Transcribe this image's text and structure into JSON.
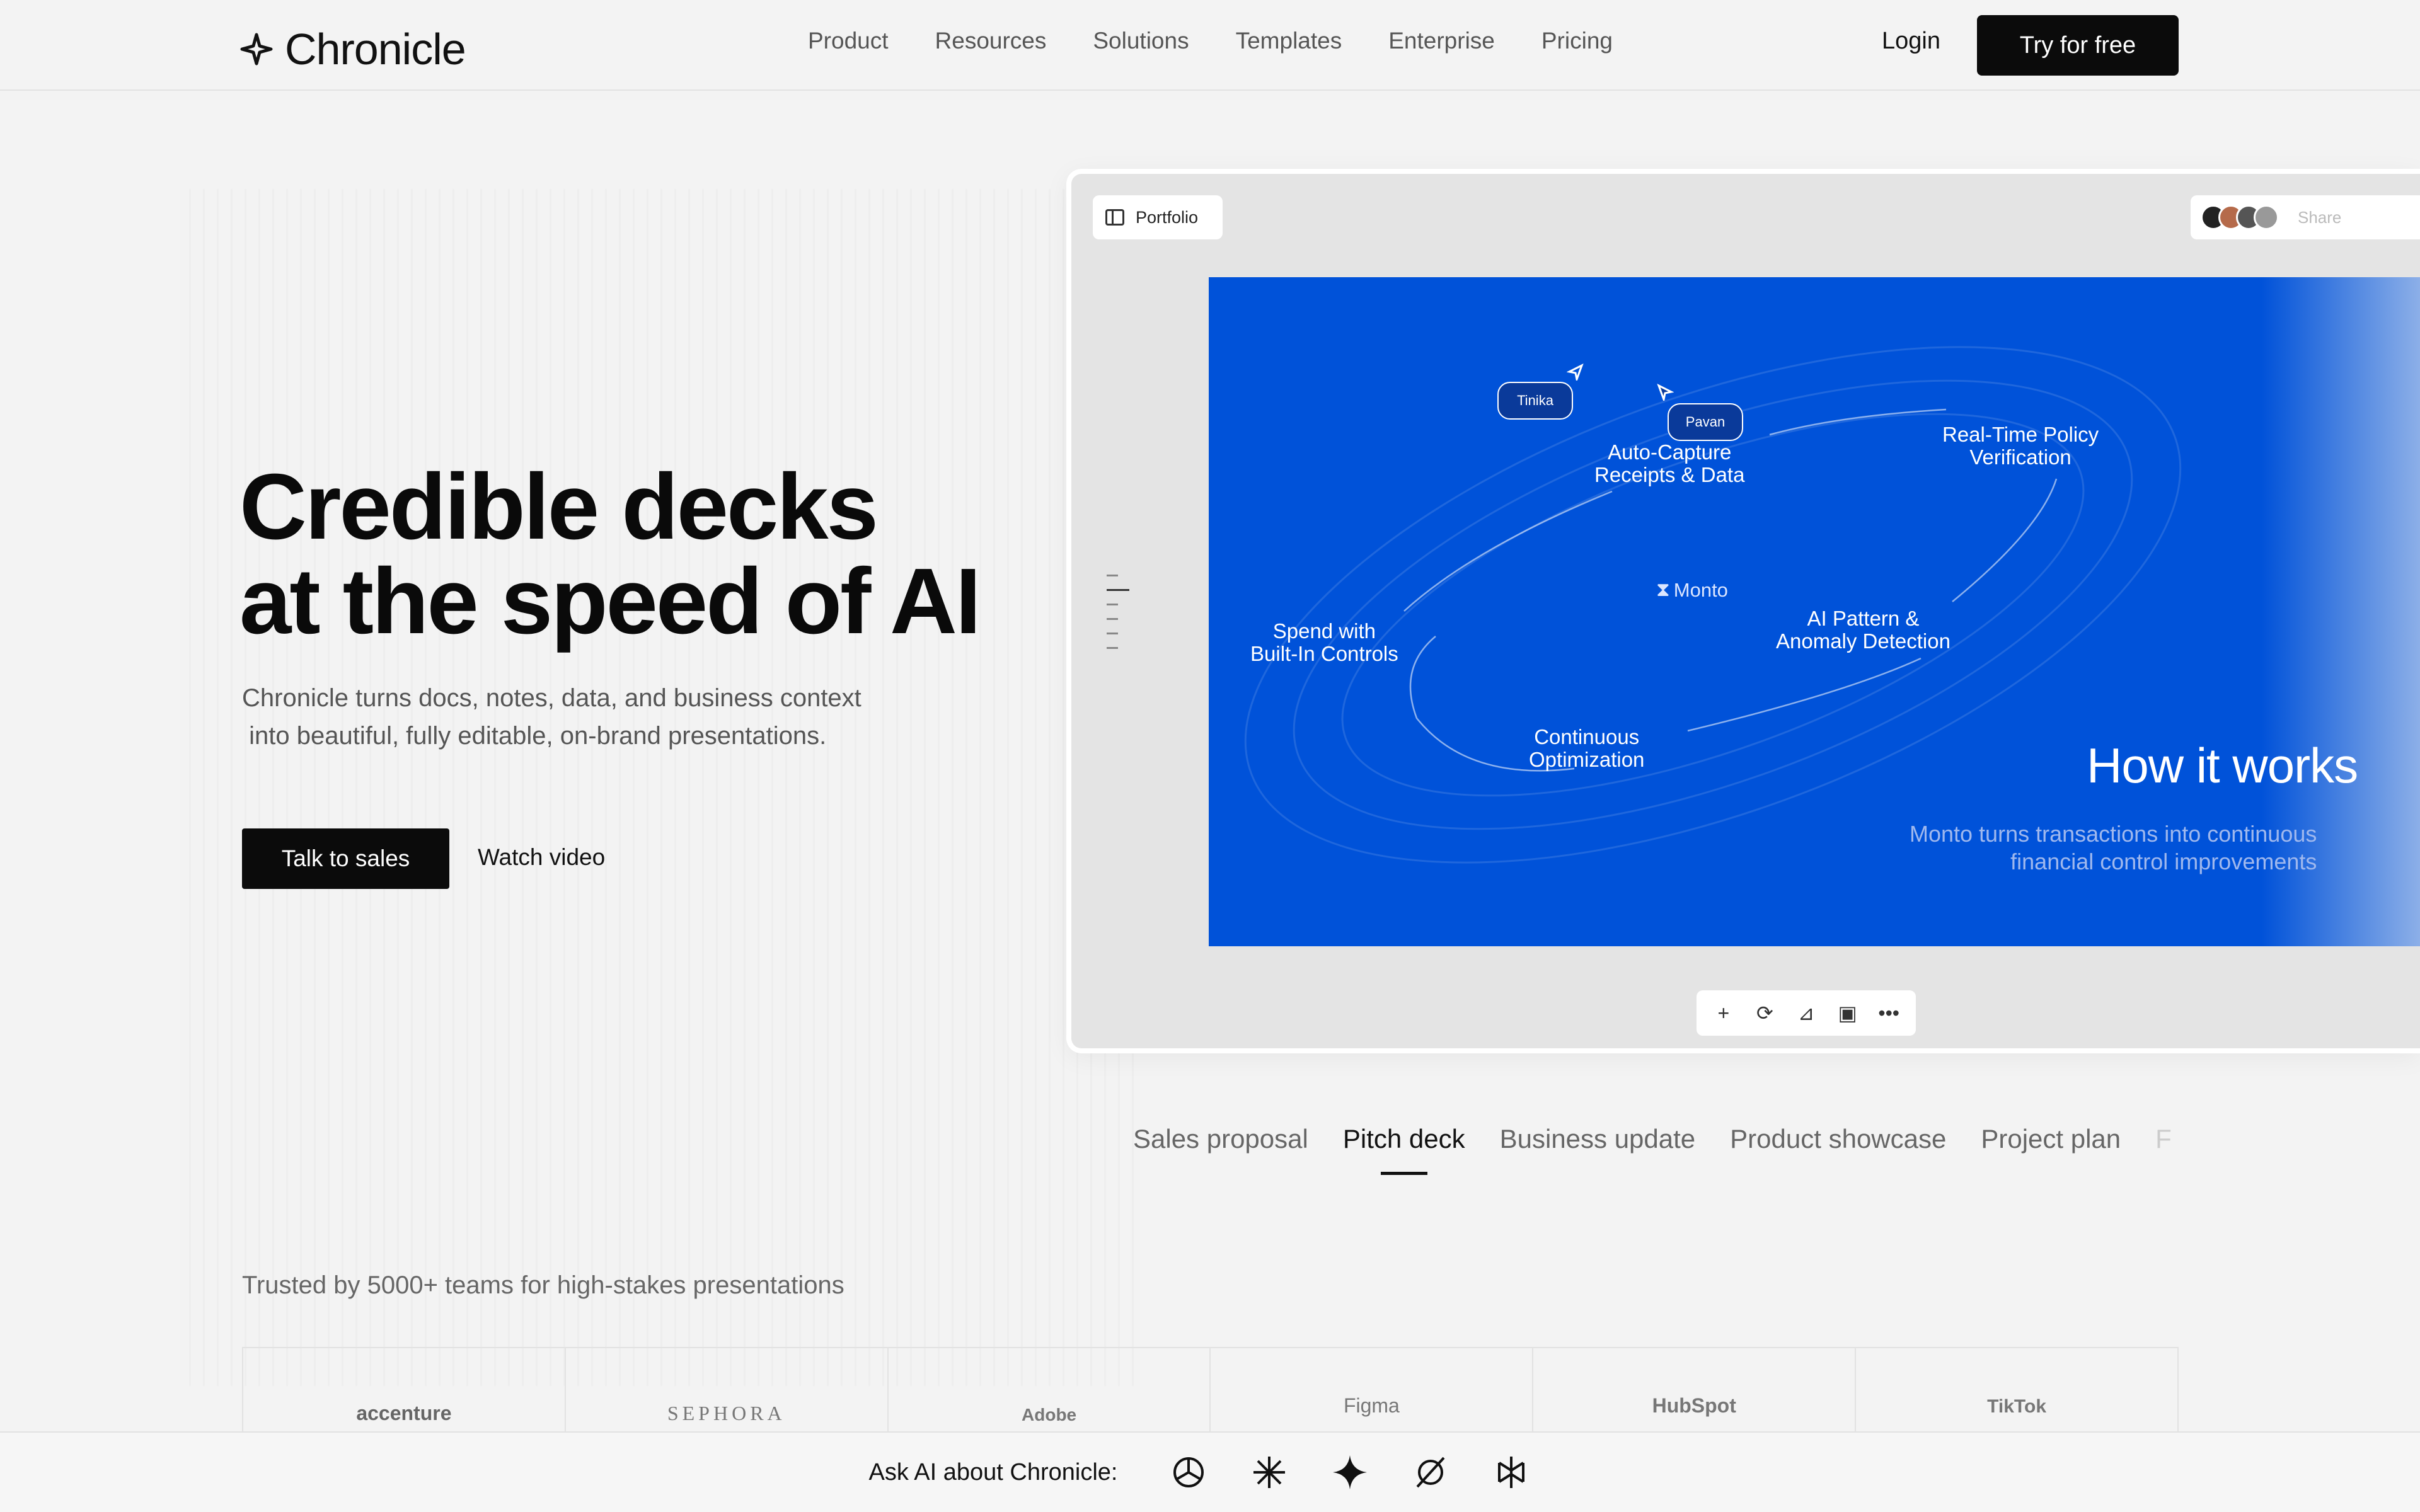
{
  "nav": {
    "brand": "Chronicle",
    "links": [
      "Product",
      "Resources",
      "Solutions",
      "Templates",
      "Enterprise",
      "Pricing"
    ],
    "login": "Login",
    "cta": "Try for free"
  },
  "hero": {
    "title_line1": "Credible decks",
    "title_line2": "at the speed of AI",
    "subtitle_line1": "Chronicle turns docs, notes, data, and business context",
    "subtitle_line2": " into beautiful, fully editable, on-brand presentations.",
    "primary_button": "Talk to sales",
    "secondary_button": "Watch video"
  },
  "editor": {
    "doc_chip": "Portfolio",
    "share_label": "Share",
    "slide": {
      "labels": {
        "auto_capture": "Auto-Capture\nReceipts & Data",
        "real_time": "Real-Time Policy\nVerification",
        "spend": "Spend with\nBuilt-In Controls",
        "ai_pattern": "AI Pattern &\nAnomaly Detection",
        "continuous": "Continuous\nOptimization"
      },
      "center_brand": "Monto",
      "cursors": [
        "Tinika",
        "Pavan"
      ],
      "heading": "How it works",
      "subheading_line1": "Monto turns transactions into continuous",
      "subheading_line2": "financial control improvements"
    },
    "toolbar": [
      "plus-icon",
      "ai-icon",
      "chart-icon",
      "frame-icon",
      "more-icon"
    ]
  },
  "tabs": {
    "items": [
      "Sales proposal",
      "Pitch deck",
      "Business update",
      "Product showcase",
      "Project plan",
      "F"
    ],
    "active": "Pitch deck"
  },
  "trusted": {
    "text": "Trusted by 5000+ teams for high-stakes presentations",
    "logos": [
      "accenture",
      "SEPHORA",
      "Adobe",
      "Figma",
      "HubSpot",
      "TikTok"
    ]
  },
  "ask_ai": {
    "label": "Ask AI about Chronicle:",
    "icons": [
      "chatgpt-icon",
      "claude-icon",
      "gemini-icon",
      "perplexity-icon",
      "grok-icon"
    ]
  },
  "colors": {
    "slide_blue": "#0052d9",
    "button_black": "#0b0b0b",
    "background": "#f3f3f3"
  }
}
